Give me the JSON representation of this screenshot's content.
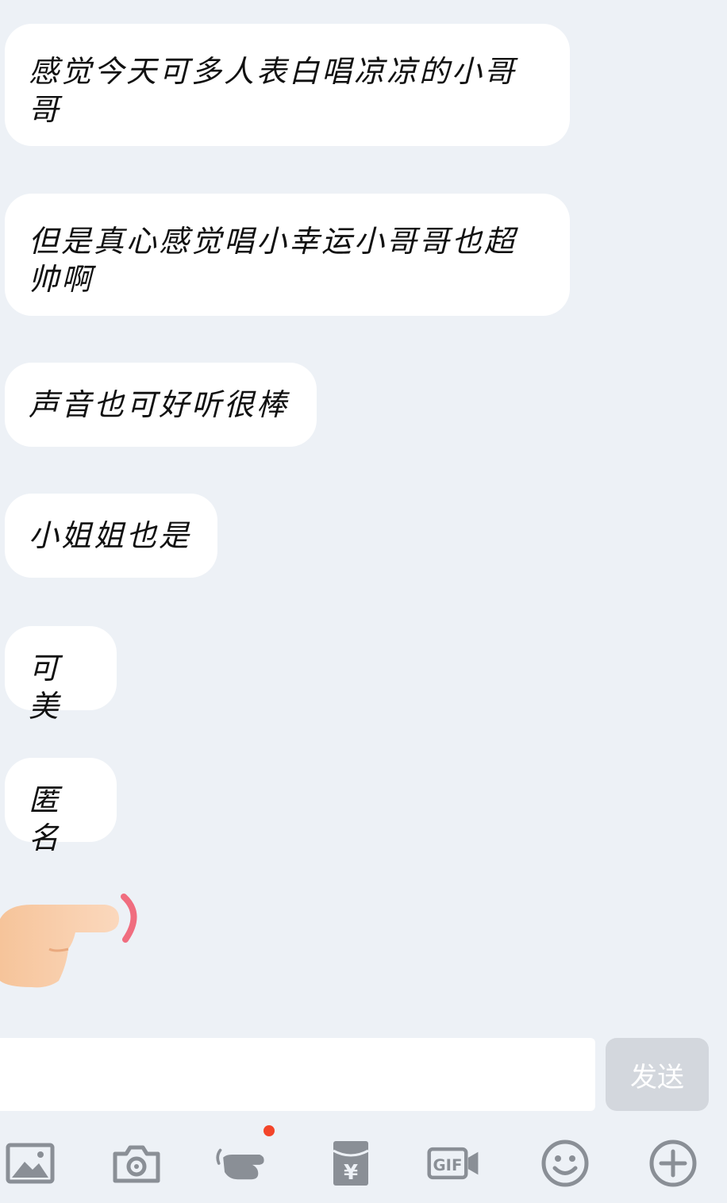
{
  "messages": [
    {
      "lines": [
        "感觉今天可多人表白唱凉凉的小哥",
        "哥"
      ]
    },
    {
      "lines": [
        "但是真心感觉唱小幸运小哥哥也超",
        "帅啊"
      ]
    },
    {
      "lines": [
        "声音也可好听很棒"
      ]
    },
    {
      "lines": [
        "小姐姐也是"
      ]
    },
    {
      "lines": [
        "可美"
      ]
    },
    {
      "lines": [
        "匿名"
      ]
    }
  ],
  "composer": {
    "input_value": "",
    "send_label": "发送"
  },
  "toolbar": {
    "items": [
      "image-icon",
      "camera-icon",
      "poke-icon",
      "red-packet-icon",
      "gif-icon",
      "emoji-icon",
      "add-icon"
    ],
    "badge_color": "#f3452a",
    "icon_color": "#8a8f96"
  },
  "colors": {
    "background": "#edf1f6",
    "bubble": "#ffffff",
    "send_disabled": "#d3d7dd"
  }
}
